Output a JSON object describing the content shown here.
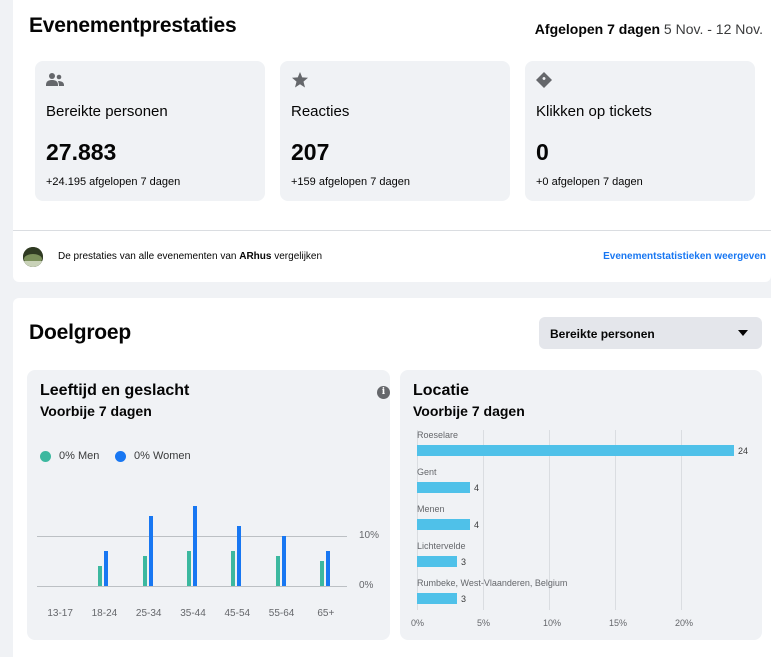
{
  "performance": {
    "title": "Evenementprestaties",
    "range_bold": "Afgelopen 7 dagen",
    "range_dates": "5 Nov. - 12 Nov.",
    "stats": [
      {
        "icon": "people-icon",
        "label": "Bereikte personen",
        "value": "27.883",
        "delta": "+24.195 afgelopen 7 dagen"
      },
      {
        "icon": "star-icon",
        "label": "Reacties",
        "value": "207",
        "delta": "+159 afgelopen 7 dagen"
      },
      {
        "icon": "ticket-icon",
        "label": "Klikken op tickets",
        "value": "0",
        "delta": "+0 afgelopen 7 dagen"
      }
    ],
    "compare_prefix": "De prestaties van alle evenementen van ",
    "compare_page": "ARhus",
    "compare_suffix": " vergelijken",
    "compare_link": "Evenementstatistieken weergeven"
  },
  "audience": {
    "title": "Doelgroep",
    "metric_select": "Bereikte personen",
    "age_gender": {
      "title": "Leeftijd en geslacht",
      "subtitle": "Voorbije 7 dagen",
      "legend_men": "0% Men",
      "legend_women": "0% Women",
      "colors": {
        "men": "#3cb89f",
        "women": "#1877f2"
      }
    },
    "location": {
      "title": "Locatie",
      "subtitle": "Voorbije 7 dagen",
      "bar_color": "#4fc1e9"
    }
  },
  "chart_data": [
    {
      "type": "bar",
      "categories": [
        "13-17",
        "18-24",
        "25-34",
        "35-44",
        "45-54",
        "55-64",
        "65+"
      ],
      "series": [
        {
          "name": "Men",
          "values": [
            0,
            4,
            6,
            7,
            7,
            6,
            5
          ]
        },
        {
          "name": "Women",
          "values": [
            0,
            7,
            14,
            16,
            12,
            10,
            7
          ]
        }
      ],
      "yticks": [
        "0%",
        "10%"
      ],
      "ylim": [
        0,
        20
      ]
    },
    {
      "type": "bar",
      "orientation": "horizontal",
      "categories": [
        "Roeselare",
        "Gent",
        "Menen",
        "Lichtervelde",
        "Rumbeke, West-Vlaanderen, Belgium"
      ],
      "values": [
        24,
        4,
        4,
        3,
        3
      ],
      "value_labels": [
        "24",
        "4",
        "4",
        "3",
        "3"
      ],
      "xticks": [
        "0%",
        "5%",
        "10%",
        "15%",
        "20%"
      ]
    }
  ]
}
